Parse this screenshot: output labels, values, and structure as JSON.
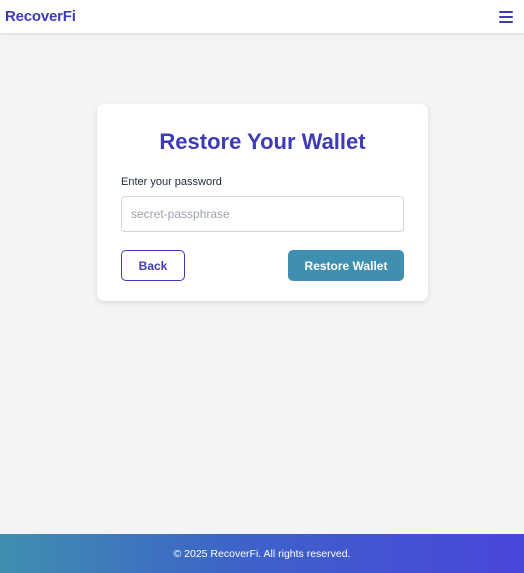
{
  "header": {
    "brand": "RecoverFi",
    "menu_icon": "hamburger-menu-icon"
  },
  "restore_card": {
    "title": "Restore Your Wallet",
    "password_label": "Enter your password",
    "password_placeholder": "secret-passphrase",
    "password_value": "",
    "back_label": "Back",
    "restore_label": "Restore Wallet"
  },
  "footer": {
    "copyright": "© 2025 RecoverFi. All rights reserved."
  },
  "colors": {
    "brand": "#3f3bb8",
    "primary_button": "#3f8fb0",
    "background": "#f3f4f6",
    "footer_gradient_start": "#3f8fb0",
    "footer_gradient_end": "#4a45dc"
  }
}
